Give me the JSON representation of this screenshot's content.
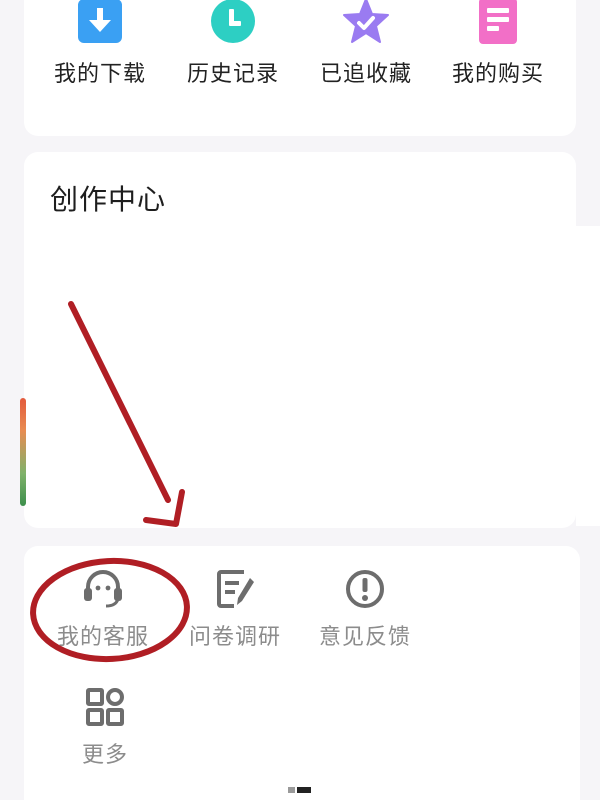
{
  "quick_actions": [
    {
      "label": "我的下载",
      "icon": "download-icon",
      "color": "#3aa0f3"
    },
    {
      "label": "历史记录",
      "icon": "clock-icon",
      "color": "#2dcfc3"
    },
    {
      "label": "已追收藏",
      "icon": "star-icon",
      "color": "#9a7bf1"
    },
    {
      "label": "我的购买",
      "icon": "receipt-icon",
      "color": "#f26fc7"
    }
  ],
  "creator": {
    "title": "创作中心"
  },
  "services": [
    {
      "label": "我的客服",
      "icon": "customer-service-icon"
    },
    {
      "label": "问卷调研",
      "icon": "survey-icon"
    },
    {
      "label": "意见反馈",
      "icon": "feedback-icon"
    },
    {
      "label": "更多",
      "icon": "more-grid-icon"
    }
  ],
  "colors": {
    "background": "#f6f5f8",
    "annotation": "#b01e24",
    "muted_text": "#8c8c8c",
    "icon_gray": "#6d6d6d"
  }
}
